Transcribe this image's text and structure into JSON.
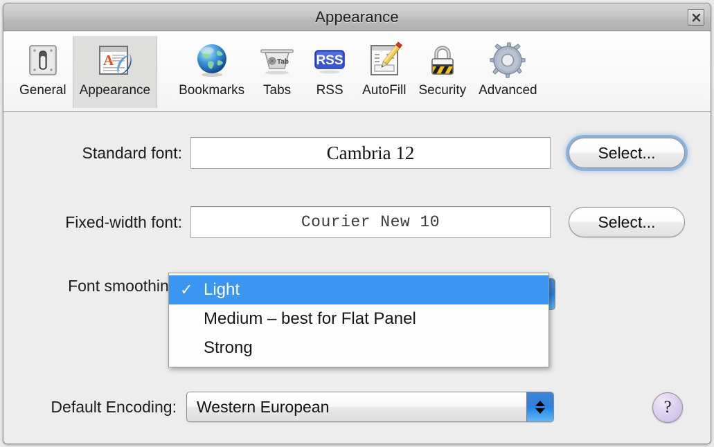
{
  "window": {
    "title": "Appearance",
    "close_label": "✕",
    "close_icon": "close-icon"
  },
  "toolbar": {
    "items": [
      {
        "label": "General",
        "icon": "toggle-switch-icon",
        "selected": false
      },
      {
        "label": "Appearance",
        "icon": "appearance-window-icon",
        "selected": true
      },
      {
        "label": "Bookmarks",
        "icon": "globe-icon",
        "selected": false
      },
      {
        "label": "Tabs",
        "icon": "tab-icon",
        "selected": false
      },
      {
        "label": "RSS",
        "icon": "rss-icon",
        "selected": false
      },
      {
        "label": "AutoFill",
        "icon": "form-pencil-icon",
        "selected": false
      },
      {
        "label": "Security",
        "icon": "padlock-icon",
        "selected": false
      },
      {
        "label": "Advanced",
        "icon": "gear-icon",
        "selected": false
      }
    ]
  },
  "form": {
    "standard_font": {
      "label": "Standard font:",
      "value": "Cambria 12",
      "button_label": "Select..."
    },
    "fixed_width_font": {
      "label": "Fixed-width font:",
      "value": "Courier New 10",
      "button_label": "Select..."
    },
    "font_smoothing": {
      "label": "Font smoothing:",
      "selected": "Light",
      "options": [
        {
          "label": "Light",
          "checked": true
        },
        {
          "label": "Medium – best for Flat Panel",
          "checked": false
        },
        {
          "label": "Strong",
          "checked": false
        }
      ]
    },
    "default_encoding": {
      "label": "Default Encoding:",
      "value": "Western European"
    },
    "help_label": "?"
  },
  "colors": {
    "menu_highlight": "#3b96f2",
    "stepper_blue": "#2f7fd8",
    "help_purple": "#c8b8e6",
    "rss_blue": "#3a57d0",
    "content_bg": "#ededed"
  }
}
